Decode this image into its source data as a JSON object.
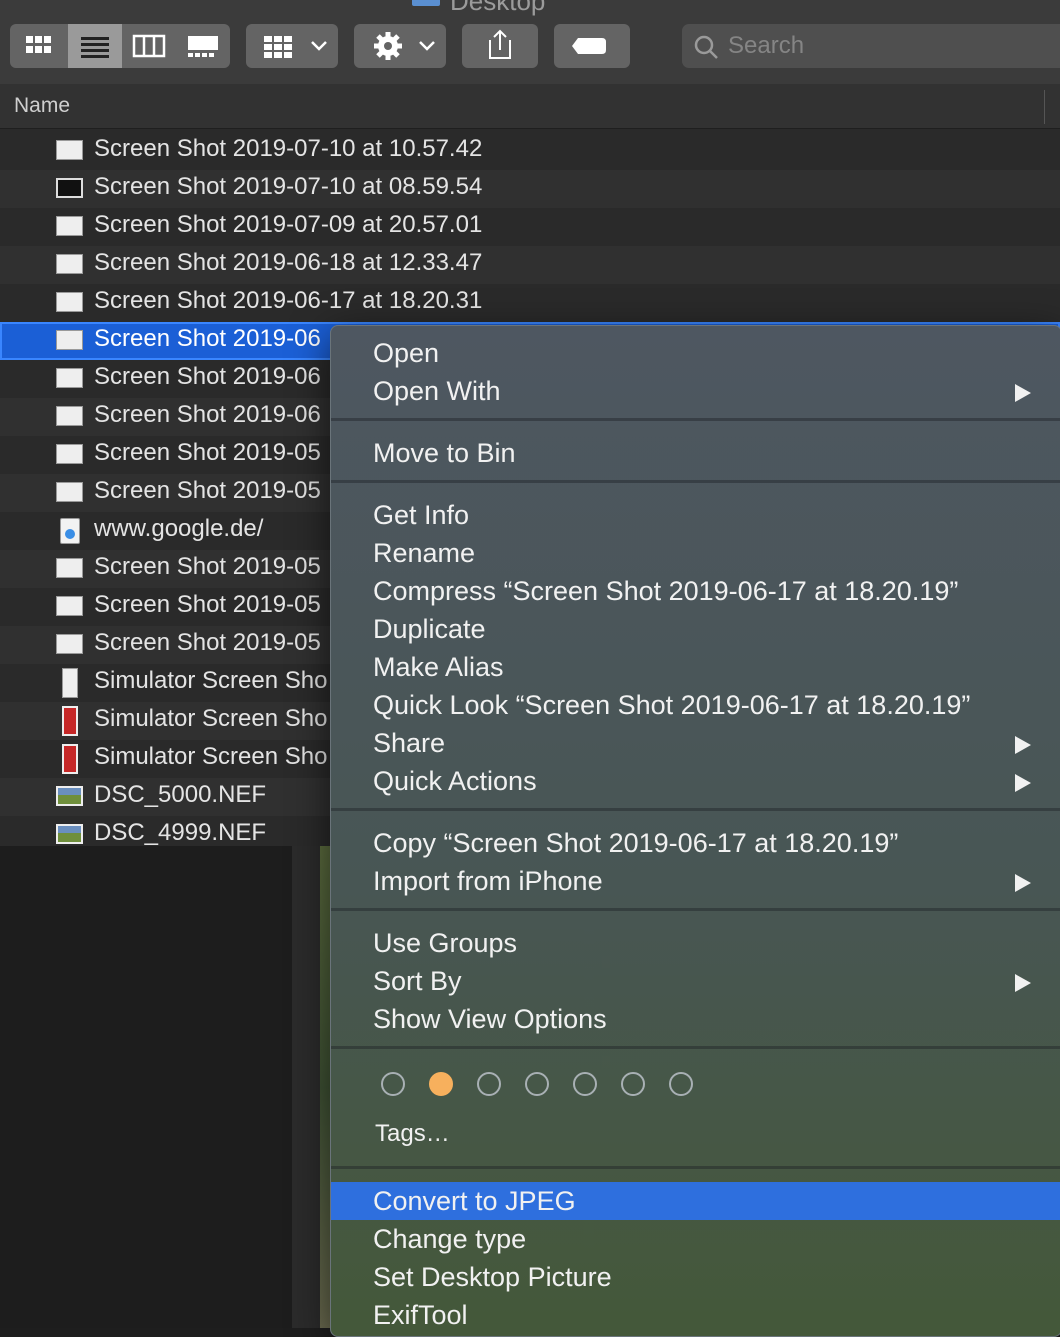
{
  "toolbar": {
    "window_title": "Desktop",
    "search": {
      "placeholder": "Search"
    },
    "view_modes": [
      "icon-view",
      "list-view",
      "column-view",
      "gallery-view"
    ],
    "icons": [
      "group-icon",
      "gear-icon",
      "share-icon",
      "tag-icon",
      "search-icon"
    ]
  },
  "filelist": {
    "column_header": "Name",
    "rows": [
      {
        "name": "Screen Shot 2019-07-10 at 10.57.42",
        "icon": "screenshot-icon"
      },
      {
        "name": "Screen Shot 2019-07-10 at 08.59.54",
        "icon": "screenshot-dark-icon"
      },
      {
        "name": "Screen Shot 2019-07-09 at 20.57.01",
        "icon": "screenshot-icon"
      },
      {
        "name": "Screen Shot 2019-06-18 at 12.33.47",
        "icon": "screenshot-icon"
      },
      {
        "name": "Screen Shot 2019-06-17 at 18.20.31",
        "icon": "screenshot-icon"
      },
      {
        "name": "Screen Shot 2019-06",
        "icon": "screenshot-icon",
        "selected": true
      },
      {
        "name": "Screen Shot 2019-06",
        "icon": "screenshot-icon"
      },
      {
        "name": "Screen Shot 2019-06",
        "icon": "screenshot-icon"
      },
      {
        "name": "Screen Shot 2019-05",
        "icon": "screenshot-icon"
      },
      {
        "name": "Screen Shot 2019-05",
        "icon": "screenshot-icon"
      },
      {
        "name": "www.google.de/",
        "icon": "webloc-icon"
      },
      {
        "name": "Screen Shot 2019-05",
        "icon": "screenshot-icon"
      },
      {
        "name": "Screen Shot 2019-05",
        "icon": "screenshot-icon"
      },
      {
        "name": "Screen Shot 2019-05",
        "icon": "screenshot-icon"
      },
      {
        "name": "Simulator Screen Sho",
        "icon": "phone-screenshot-icon"
      },
      {
        "name": "Simulator Screen Sho",
        "icon": "phone-screenshot-red-icon"
      },
      {
        "name": "Simulator Screen Sho",
        "icon": "phone-screenshot-red-icon"
      },
      {
        "name": "DSC_5000.NEF",
        "icon": "photo-icon"
      },
      {
        "name": "DSC_4999.NEF",
        "icon": "photo-icon"
      }
    ]
  },
  "context_menu": {
    "groups": [
      [
        {
          "label": "Open"
        },
        {
          "label": "Open With",
          "submenu": true
        }
      ],
      [
        {
          "label": "Move to Bin"
        }
      ],
      [
        {
          "label": "Get Info"
        },
        {
          "label": "Rename"
        },
        {
          "label": "Compress “Screen Shot 2019-06-17 at 18.20.19”"
        },
        {
          "label": "Duplicate"
        },
        {
          "label": "Make Alias"
        },
        {
          "label": "Quick Look “Screen Shot 2019-06-17 at 18.20.19”"
        },
        {
          "label": "Share",
          "submenu": true
        },
        {
          "label": "Quick Actions",
          "submenu": true
        }
      ],
      [
        {
          "label": "Copy “Screen Shot 2019-06-17 at 18.20.19”"
        },
        {
          "label": "Import from iPhone",
          "submenu": true
        }
      ],
      [
        {
          "label": "Use Groups"
        },
        {
          "label": "Sort By",
          "submenu": true
        },
        {
          "label": "Show View Options"
        }
      ],
      [
        {
          "label": "Convert to JPEG",
          "highlighted": true
        },
        {
          "label": "Change type"
        },
        {
          "label": "Set Desktop Picture"
        },
        {
          "label": "ExifTool"
        }
      ]
    ],
    "tags": {
      "colors": [
        "none",
        "#f7b05d",
        "none",
        "none",
        "none",
        "none",
        "none"
      ],
      "label": "Tags…"
    }
  },
  "colors": {
    "selection": "#1b5fd6",
    "menu_highlight": "#2e6fde",
    "tag_orange": "#f7b05d"
  }
}
